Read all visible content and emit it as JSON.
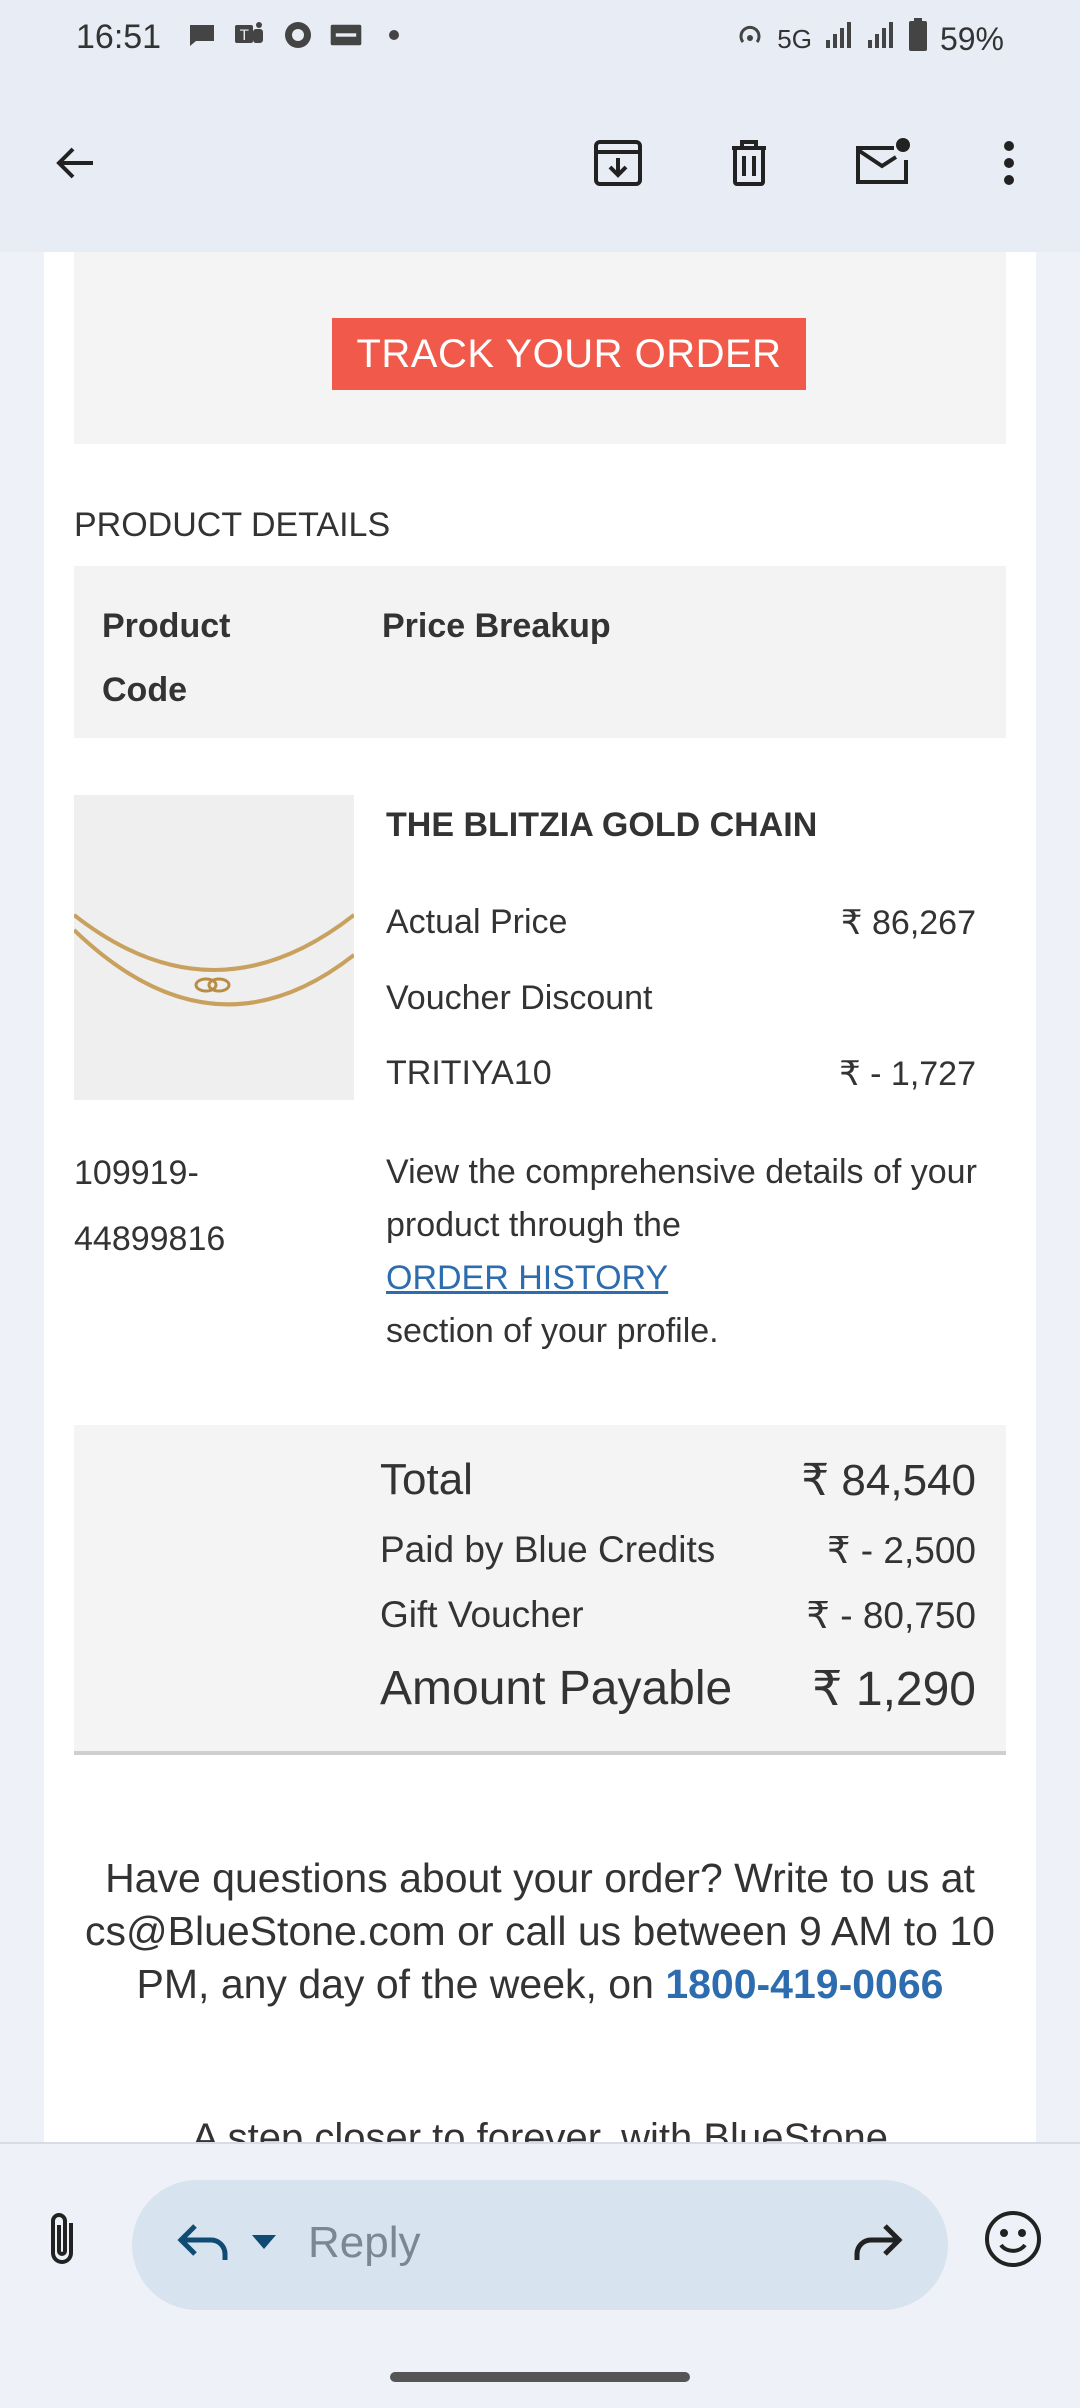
{
  "status_bar": {
    "time": "16:51",
    "network": "5G",
    "battery": "59%"
  },
  "icons": {
    "back": "arrow-left-icon",
    "archive": "archive-icon",
    "delete": "trash-icon",
    "mark_unread": "mail-unread-icon",
    "more": "more-vert-icon",
    "attach": "paperclip-icon",
    "reply": "reply-icon",
    "forward": "forward-icon",
    "emoji": "emoji-icon"
  },
  "email": {
    "track_button": "TRACK YOUR ORDER",
    "product_details_title": "PRODUCT DETAILS",
    "header_product_code": "Product Code",
    "header_price_breakup": "Price Breakup",
    "product_name": "THE BLITZIA GOLD CHAIN",
    "actual_price_label": "Actual Price",
    "actual_price_value": "₹ 86,267",
    "voucher_label": "Voucher Discount",
    "voucher_code": "TRITIYA10",
    "voucher_value": "₹ - 1,727",
    "product_code_line1": "109919-",
    "product_code_line2": "44899816",
    "desc_before": "View the comprehensive details of your product through the",
    "desc_link": "ORDER HISTORY",
    "desc_after": "section of your profile.",
    "total_label": "Total",
    "total_value": "₹ 84,540",
    "blue_credits_label": "Paid by Blue Credits",
    "blue_credits_value": "₹ - 2,500",
    "gift_voucher_label": "Gift Voucher",
    "gift_voucher_value": "₹ - 80,750",
    "amount_payable_label": "Amount Payable",
    "amount_payable_value": "₹ 1,290",
    "help_text": "Have questions about your order? Write to us at cs@BlueStone.com or call us between 9 AM to 10 PM, any day of the week, on",
    "help_phone": "1800-419-0066",
    "tagline": "A step closer to forever, with BlueStone"
  },
  "reply_bar": {
    "placeholder": "Reply"
  },
  "colors": {
    "track_button": "#f15a4a",
    "link": "#2d6cae",
    "reply_pill": "#d7e3ee"
  }
}
